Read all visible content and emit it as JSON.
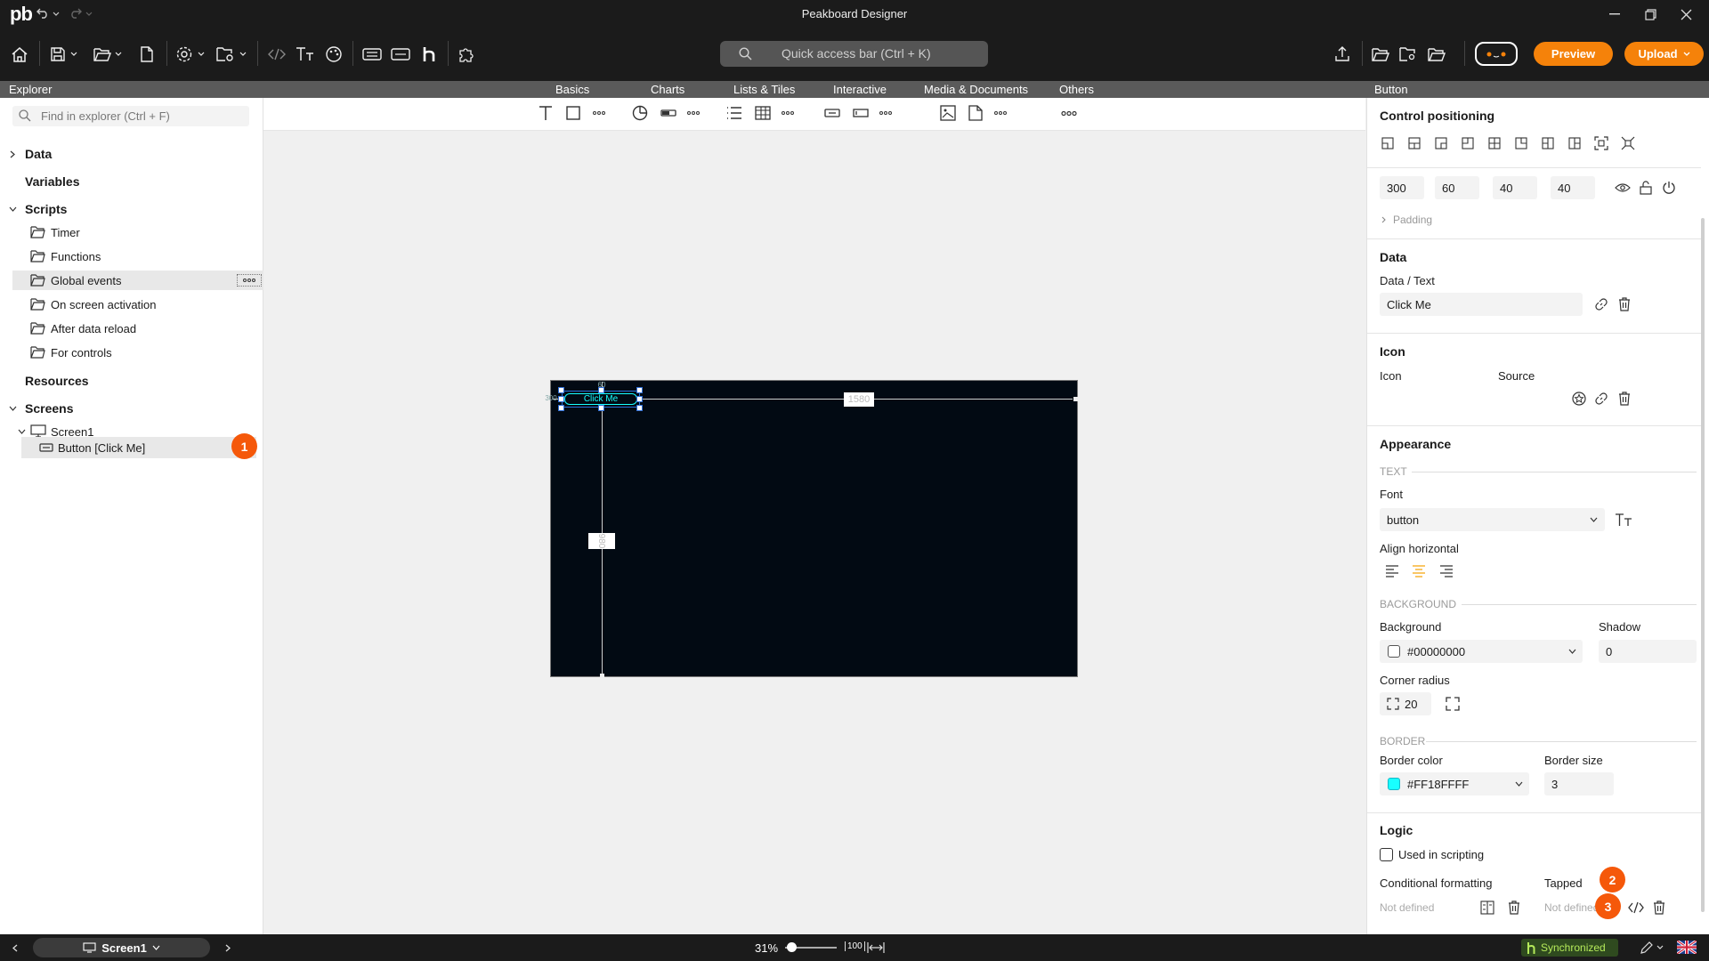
{
  "app": {
    "title": "Peakboard Designer",
    "logo": "pb"
  },
  "quick_access": {
    "placeholder": "Quick access bar (Ctrl + K)"
  },
  "actions": {
    "preview": "Preview",
    "upload": "Upload"
  },
  "header": {
    "explorer": "Explorer",
    "panel": "Button"
  },
  "tool_categories": [
    "Basics",
    "Charts",
    "Lists & Tiles",
    "Interactive",
    "Media & Documents",
    "Others"
  ],
  "explorer": {
    "search_placeholder": "Find in explorer (Ctrl + F)",
    "data": "Data",
    "variables": "Variables",
    "scripts": "Scripts",
    "script_items": [
      "Timer",
      "Functions",
      "Global events",
      "On screen activation",
      "After data reload",
      "For controls"
    ],
    "resources": "Resources",
    "screens": "Screens",
    "screen1": "Screen1",
    "button_item": "Button [Click Me]",
    "badge1": "1"
  },
  "canvas": {
    "button_text": "Click Me",
    "width_label": "1580",
    "height_label": "980",
    "button_left_label": "300",
    "button_top_label": "60",
    "background": "#020a13",
    "button_color": "#18ffff"
  },
  "props": {
    "control_positioning": "Control positioning",
    "pos": [
      "300",
      "60",
      "40",
      "40"
    ],
    "padding": "Padding",
    "data_h": "Data",
    "data_text_label": "Data / Text",
    "data_text_value": "Click Me",
    "icon_h": "Icon",
    "icon_label": "Icon",
    "source_label": "Source",
    "appearance_h": "Appearance",
    "text_section": "TEXT",
    "font_label": "Font",
    "font_value": "button",
    "align_label": "Align horizontal",
    "bg_section": "BACKGROUND",
    "background_label": "Background",
    "background_value": "#00000000",
    "shadow_label": "Shadow",
    "shadow_value": "0",
    "corner_label": "Corner radius",
    "corner_value": "20",
    "border_section": "BORDER",
    "border_color_label": "Border color",
    "border_color_value": "#FF18FFFF",
    "border_size_label": "Border size",
    "border_size_value": "3",
    "logic_h": "Logic",
    "used_in_scripting": "Used in scripting",
    "cond_formatting": "Conditional formatting",
    "cond_value": "Not defined",
    "tapped_label": "Tapped",
    "tapped_value": "Not defined",
    "badge2": "2",
    "badge3": "3"
  },
  "status": {
    "screen": "Screen1",
    "zoom": "31%",
    "fit": "100",
    "sync": "Synchronized"
  }
}
